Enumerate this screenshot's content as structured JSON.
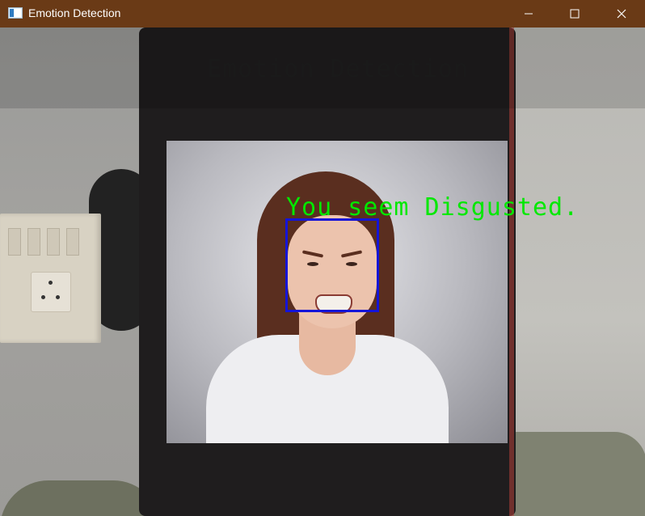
{
  "window": {
    "title": "Emotion Detection",
    "controls": {
      "minimize_icon": "minimize-icon",
      "maximize_icon": "maximize-icon",
      "close_icon": "close-icon"
    }
  },
  "overlay": {
    "heading": "Emotion Detection",
    "emotion_label": "You seem Disgusted.",
    "label_color": "#00e800",
    "face_box_color": "#1414d8"
  }
}
